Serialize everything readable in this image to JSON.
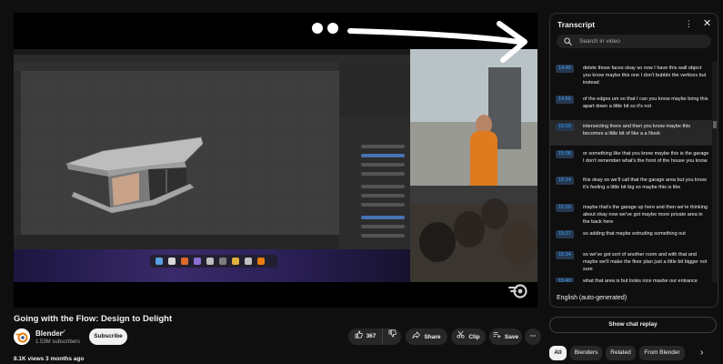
{
  "video": {
    "title": "Going with the Flow: Design to Delight"
  },
  "channel": {
    "name": "Blender",
    "verified_mark": "✔",
    "subscribers": "1.53M subscribers",
    "subscribe_label": "Subscribe"
  },
  "actions": {
    "like_count": "367",
    "share_label": "Share",
    "clip_label": "Clip",
    "save_label": "Save",
    "more_glyph": "⋯"
  },
  "stats": {
    "views_and_age": "8.1K views  3 months ago"
  },
  "transcript": {
    "title": "Transcript",
    "search_placeholder": "Search in video",
    "language": "English (auto-generated)",
    "segments": [
      {
        "time": "14:49",
        "text": "delete those faces okay so now I have this wall object you know maybe this one I don't bubble the vertices but instead",
        "active": false
      },
      {
        "time": "14:56",
        "text": "of the edges um so that I can you know maybe bring this apart down a little bit so it's not",
        "active": false
      },
      {
        "time": "15:03",
        "text": "intersecting there and then you know maybe this becomes a little bit of like a a Nook",
        "active": true
      },
      {
        "time": "15:08",
        "text": "or something like that you know maybe this is the garage I don't remember what's the front of the house you know",
        "active": false
      },
      {
        "time": "15:14",
        "text": "this okay so we'll call that the garage area but you know it's feeling a little bit big so maybe this is like",
        "active": false
      },
      {
        "time": "15:20",
        "text": "maybe that's the garage up here and then we're thinking about okay now we've got maybe more private area in the back here",
        "active": false
      },
      {
        "time": "15:27",
        "text": "so adding that maybe extruding something out",
        "active": false
      },
      {
        "time": "15:34",
        "text": "so we've got sort of another room and with that and maybe we'll make the floor plan just a little bit bigger not sure",
        "active": false
      },
      {
        "time": "15:40",
        "text": "what that area is but looks nice maybe our entrance would be somewhere somewhere around there so",
        "active": false
      }
    ]
  },
  "sidebar": {
    "chat_replay_label": "Show chat replay",
    "chips": [
      "All",
      "Blenders",
      "Related",
      "From Blender"
    ]
  },
  "colors": {
    "background": "#0f0f0f",
    "timestamp_blue": "#3ea6ff",
    "active_segment": "#272727",
    "arrow": "#ffffff"
  }
}
